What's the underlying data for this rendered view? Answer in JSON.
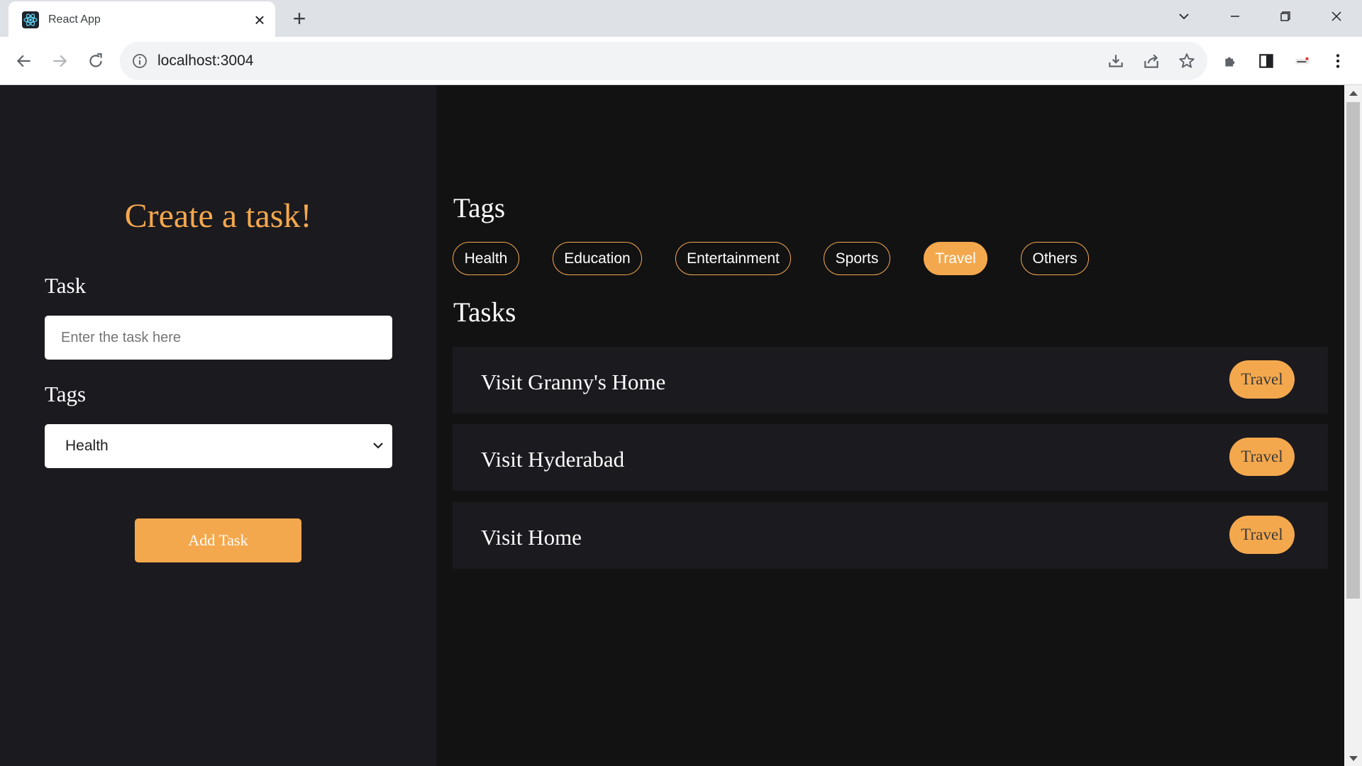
{
  "browser": {
    "tab_title": "React App",
    "url": "localhost:3004"
  },
  "form": {
    "heading": "Create a task!",
    "task_label": "Task",
    "task_placeholder": "Enter the task here",
    "tags_label": "Tags",
    "tag_selected": "Health",
    "add_button": "Add Task"
  },
  "tags_section": {
    "title": "Tags",
    "tags": [
      {
        "label": "Health",
        "active": false
      },
      {
        "label": "Education",
        "active": false
      },
      {
        "label": "Entertainment",
        "active": false
      },
      {
        "label": "Sports",
        "active": false
      },
      {
        "label": "Travel",
        "active": true
      },
      {
        "label": "Others",
        "active": false
      }
    ]
  },
  "tasks_section": {
    "title": "Tasks",
    "tasks": [
      {
        "name": "Visit Granny's Home",
        "tag": "Travel"
      },
      {
        "name": "Visit Hyderabad",
        "tag": "Travel"
      },
      {
        "name": "Visit Home",
        "tag": "Travel"
      }
    ]
  },
  "colors": {
    "accent": "#f4a84d",
    "left_panel_bg": "#1b1a1f",
    "right_panel_bg": "#121213",
    "task_row_bg": "#1b1a1f"
  }
}
